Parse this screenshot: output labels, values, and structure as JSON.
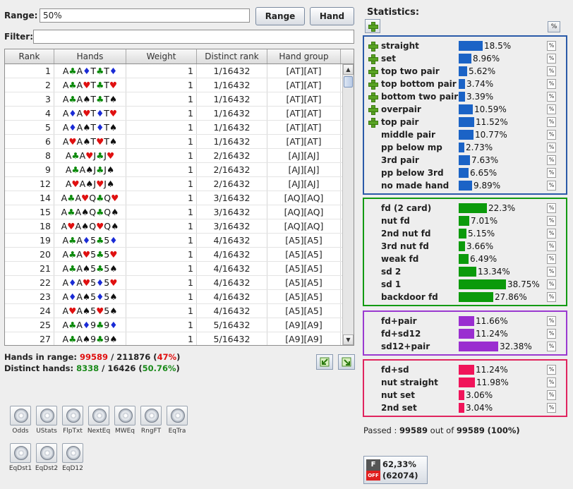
{
  "range": {
    "label": "Range:",
    "value": "50%",
    "range_button": "Range",
    "hand_button": "Hand"
  },
  "filter": {
    "label": "Filter:",
    "value": ""
  },
  "table": {
    "columns": [
      "Rank",
      "Hands",
      "Weight",
      "Distinct rank",
      "Hand group"
    ],
    "rows": [
      {
        "rank": "1",
        "hand": [
          [
            "A",
            "c"
          ],
          [
            "A",
            "d"
          ],
          [
            "T",
            "c"
          ],
          [
            "T",
            "d"
          ]
        ],
        "weight": "1",
        "distinct": "1/16432",
        "group": "[AT][AT]"
      },
      {
        "rank": "2",
        "hand": [
          [
            "A",
            "c"
          ],
          [
            "A",
            "h"
          ],
          [
            "T",
            "c"
          ],
          [
            "T",
            "h"
          ]
        ],
        "weight": "1",
        "distinct": "1/16432",
        "group": "[AT][AT]"
      },
      {
        "rank": "3",
        "hand": [
          [
            "A",
            "c"
          ],
          [
            "A",
            "s"
          ],
          [
            "T",
            "c"
          ],
          [
            "T",
            "s"
          ]
        ],
        "weight": "1",
        "distinct": "1/16432",
        "group": "[AT][AT]"
      },
      {
        "rank": "4",
        "hand": [
          [
            "A",
            "d"
          ],
          [
            "A",
            "h"
          ],
          [
            "T",
            "d"
          ],
          [
            "T",
            "h"
          ]
        ],
        "weight": "1",
        "distinct": "1/16432",
        "group": "[AT][AT]"
      },
      {
        "rank": "5",
        "hand": [
          [
            "A",
            "d"
          ],
          [
            "A",
            "s"
          ],
          [
            "T",
            "d"
          ],
          [
            "T",
            "s"
          ]
        ],
        "weight": "1",
        "distinct": "1/16432",
        "group": "[AT][AT]"
      },
      {
        "rank": "6",
        "hand": [
          [
            "A",
            "h"
          ],
          [
            "A",
            "s"
          ],
          [
            "T",
            "h"
          ],
          [
            "T",
            "s"
          ]
        ],
        "weight": "1",
        "distinct": "1/16432",
        "group": "[AT][AT]"
      },
      {
        "rank": "8",
        "hand": [
          [
            "A",
            "c"
          ],
          [
            "A",
            "h"
          ],
          [
            "J",
            "c"
          ],
          [
            "J",
            "h"
          ]
        ],
        "weight": "1",
        "distinct": "2/16432",
        "group": "[AJ][AJ]"
      },
      {
        "rank": "9",
        "hand": [
          [
            "A",
            "c"
          ],
          [
            "A",
            "s"
          ],
          [
            "J",
            "c"
          ],
          [
            "J",
            "s"
          ]
        ],
        "weight": "1",
        "distinct": "2/16432",
        "group": "[AJ][AJ]"
      },
      {
        "rank": "12",
        "hand": [
          [
            "A",
            "h"
          ],
          [
            "A",
            "s"
          ],
          [
            "J",
            "h"
          ],
          [
            "J",
            "s"
          ]
        ],
        "weight": "1",
        "distinct": "2/16432",
        "group": "[AJ][AJ]"
      },
      {
        "rank": "14",
        "hand": [
          [
            "A",
            "c"
          ],
          [
            "A",
            "h"
          ],
          [
            "Q",
            "c"
          ],
          [
            "Q",
            "h"
          ]
        ],
        "weight": "1",
        "distinct": "3/16432",
        "group": "[AQ][AQ]"
      },
      {
        "rank": "15",
        "hand": [
          [
            "A",
            "c"
          ],
          [
            "A",
            "s"
          ],
          [
            "Q",
            "c"
          ],
          [
            "Q",
            "s"
          ]
        ],
        "weight": "1",
        "distinct": "3/16432",
        "group": "[AQ][AQ]"
      },
      {
        "rank": "18",
        "hand": [
          [
            "A",
            "h"
          ],
          [
            "A",
            "s"
          ],
          [
            "Q",
            "h"
          ],
          [
            "Q",
            "s"
          ]
        ],
        "weight": "1",
        "distinct": "3/16432",
        "group": "[AQ][AQ]"
      },
      {
        "rank": "19",
        "hand": [
          [
            "A",
            "c"
          ],
          [
            "A",
            "d"
          ],
          [
            "5",
            "c"
          ],
          [
            "5",
            "d"
          ]
        ],
        "weight": "1",
        "distinct": "4/16432",
        "group": "[A5][A5]"
      },
      {
        "rank": "20",
        "hand": [
          [
            "A",
            "c"
          ],
          [
            "A",
            "h"
          ],
          [
            "5",
            "c"
          ],
          [
            "5",
            "h"
          ]
        ],
        "weight": "1",
        "distinct": "4/16432",
        "group": "[A5][A5]"
      },
      {
        "rank": "21",
        "hand": [
          [
            "A",
            "c"
          ],
          [
            "A",
            "s"
          ],
          [
            "5",
            "c"
          ],
          [
            "5",
            "s"
          ]
        ],
        "weight": "1",
        "distinct": "4/16432",
        "group": "[A5][A5]"
      },
      {
        "rank": "22",
        "hand": [
          [
            "A",
            "d"
          ],
          [
            "A",
            "h"
          ],
          [
            "5",
            "d"
          ],
          [
            "5",
            "h"
          ]
        ],
        "weight": "1",
        "distinct": "4/16432",
        "group": "[A5][A5]"
      },
      {
        "rank": "23",
        "hand": [
          [
            "A",
            "d"
          ],
          [
            "A",
            "s"
          ],
          [
            "5",
            "d"
          ],
          [
            "5",
            "s"
          ]
        ],
        "weight": "1",
        "distinct": "4/16432",
        "group": "[A5][A5]"
      },
      {
        "rank": "24",
        "hand": [
          [
            "A",
            "h"
          ],
          [
            "A",
            "s"
          ],
          [
            "5",
            "h"
          ],
          [
            "5",
            "s"
          ]
        ],
        "weight": "1",
        "distinct": "4/16432",
        "group": "[A5][A5]"
      },
      {
        "rank": "25",
        "hand": [
          [
            "A",
            "c"
          ],
          [
            "A",
            "d"
          ],
          [
            "9",
            "c"
          ],
          [
            "9",
            "d"
          ]
        ],
        "weight": "1",
        "distinct": "5/16432",
        "group": "[A9][A9]"
      },
      {
        "rank": "27",
        "hand": [
          [
            "A",
            "c"
          ],
          [
            "A",
            "s"
          ],
          [
            "9",
            "c"
          ],
          [
            "9",
            "s"
          ]
        ],
        "weight": "1",
        "distinct": "5/16432",
        "group": "[A9][A9]"
      }
    ]
  },
  "summary": {
    "hands_label": "Hands in range: ",
    "hands_value": "99589",
    "hands_sep": " / ",
    "hands_total": "211876",
    "hands_pct": "47%",
    "distinct_label": "Distinct hands: ",
    "distinct_value": "8338",
    "distinct_sep": " / ",
    "distinct_total": "16426",
    "distinct_pct": "50.76%"
  },
  "tools": [
    {
      "label": "Odds"
    },
    {
      "label": "UStats"
    },
    {
      "label": "FlpTxt"
    },
    {
      "label": "NextEq"
    },
    {
      "label": "MWEq"
    },
    {
      "label": "RngFT"
    },
    {
      "label": "EqTra"
    },
    {
      "label": "EqDst1"
    },
    {
      "label": "EqDst2"
    },
    {
      "label": "EqD12"
    }
  ],
  "statistics": {
    "title": "Statistics:",
    "pct_button": "%",
    "groups": [
      {
        "color": "#1b63c6",
        "border": "#2a5aa8",
        "items": [
          {
            "name": "straight",
            "plus": true,
            "pct": 18.5,
            "label": "18.5%"
          },
          {
            "name": "set",
            "plus": true,
            "pct": 8.96,
            "label": "8.96%"
          },
          {
            "name": "top two pair",
            "plus": true,
            "pct": 5.62,
            "label": "5.62%"
          },
          {
            "name": "top bottom pair",
            "plus": true,
            "pct": 3.74,
            "label": "3.74%"
          },
          {
            "name": "bottom two pair",
            "plus": true,
            "pct": 3.39,
            "label": "3.39%"
          },
          {
            "name": "overpair",
            "plus": true,
            "pct": 10.59,
            "label": "10.59%"
          },
          {
            "name": "top pair",
            "plus": true,
            "pct": 11.52,
            "label": "11.52%"
          },
          {
            "name": "middle pair",
            "plus": false,
            "pct": 10.77,
            "label": "10.77%"
          },
          {
            "name": "pp below mp",
            "plus": false,
            "pct": 2.73,
            "label": "2.73%"
          },
          {
            "name": "3rd pair",
            "plus": false,
            "pct": 7.63,
            "label": "7.63%"
          },
          {
            "name": "pp below 3rd",
            "plus": false,
            "pct": 6.65,
            "label": "6.65%"
          },
          {
            "name": "no made hand",
            "plus": false,
            "pct": 9.89,
            "label": "9.89%"
          }
        ]
      },
      {
        "color": "#0b9a0b",
        "border": "#129a12",
        "items": [
          {
            "name": "fd (2 card)",
            "plus": false,
            "pct": 22.3,
            "label": "22.3%"
          },
          {
            "name": "nut fd",
            "plus": false,
            "pct": 7.01,
            "label": "7.01%"
          },
          {
            "name": "2nd nut fd",
            "plus": false,
            "pct": 5.15,
            "label": "5.15%"
          },
          {
            "name": "3rd nut fd",
            "plus": false,
            "pct": 3.66,
            "label": "3.66%"
          },
          {
            "name": "weak fd",
            "plus": false,
            "pct": 6.49,
            "label": "6.49%"
          },
          {
            "name": "sd 2",
            "plus": false,
            "pct": 13.34,
            "label": "13.34%"
          },
          {
            "name": "sd 1",
            "plus": false,
            "pct": 38.75,
            "label": "38.75%"
          },
          {
            "name": "backdoor fd",
            "plus": false,
            "pct": 27.86,
            "label": "27.86%"
          }
        ]
      },
      {
        "color": "#9a2ed0",
        "border": "#9a3ad0",
        "items": [
          {
            "name": "fd+pair",
            "plus": false,
            "pct": 11.66,
            "label": "11.66%"
          },
          {
            "name": "fd+sd12",
            "plus": false,
            "pct": 11.24,
            "label": "11.24%"
          },
          {
            "name": "sd12+pair",
            "plus": false,
            "pct": 32.38,
            "label": "32.38%"
          }
        ]
      },
      {
        "color": "#f0145a",
        "border": "#e0245e",
        "items": [
          {
            "name": "fd+sd",
            "plus": false,
            "pct": 11.24,
            "label": "11.24%"
          },
          {
            "name": "nut straight",
            "plus": false,
            "pct": 11.98,
            "label": "11.98%"
          },
          {
            "name": "nut set",
            "plus": false,
            "pct": 3.06,
            "label": "3.06%"
          },
          {
            "name": "2nd set",
            "plus": false,
            "pct": 3.04,
            "label": "3.04%"
          }
        ]
      }
    ],
    "passed_label": "Passed : ",
    "passed_value": "99589",
    "passed_mid": " out of ",
    "passed_total": "99589",
    "passed_pct": "(100%)"
  },
  "status_widget": {
    "top": "F",
    "bottom": "OFF",
    "line1": "62,33%",
    "line2": "(62074)"
  }
}
